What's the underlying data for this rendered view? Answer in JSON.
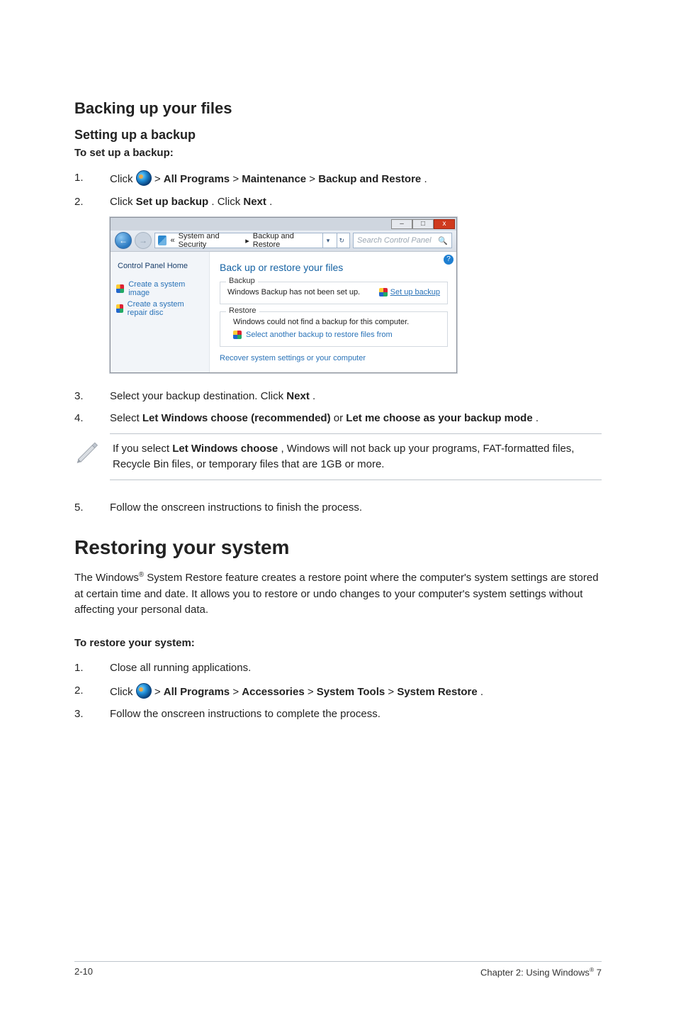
{
  "section1": {
    "title": "Backing up your files",
    "subtitle": "Setting up a backup",
    "lead": "To set up a backup:",
    "steps": {
      "s1_num": "1.",
      "s1_pre": "Click ",
      "s1_gt1": " > ",
      "s1_b1": "All Programs",
      "s1_gt2": " > ",
      "s1_b2": "Maintenance",
      "s1_gt3": " > ",
      "s1_b3": "Backup and Restore",
      "s1_end": ".",
      "s2_num": "2.",
      "s2_pre": "Click ",
      "s2_b1": "Set up backup",
      "s2_mid": ". Click ",
      "s2_b2": "Next",
      "s2_end": ".",
      "s3_num": "3.",
      "s3_pre": "Select your backup destination. Click ",
      "s3_b1": "Next",
      "s3_end": ".",
      "s4_num": "4.",
      "s4_pre": "Select ",
      "s4_b1": "Let Windows choose (recommended)",
      "s4_mid": " or ",
      "s4_b2": "Let me choose as your backup mode",
      "s4_end": ".",
      "s5_num": "5.",
      "s5_text": "Follow the onscreen instructions to finish the process."
    },
    "note": {
      "pre": "If you select ",
      "bold": "Let Windows choose",
      "post": ", Windows will not back up your programs, FAT-formatted files, Recycle Bin files, or temporary files that are 1GB or more."
    }
  },
  "screenshot": {
    "min_label": "–",
    "max_label": "□",
    "close_label": "x",
    "back_arrow": "←",
    "fwd_arrow": "→",
    "breadcrumb_prefix": "« ",
    "breadcrumb_1": "System and Security",
    "breadcrumb_sep": "  ▸  ",
    "breadcrumb_2": "Backup and Restore",
    "addr_drop": "▾",
    "addr_refresh": "↻",
    "search_placeholder": "Search Control Panel",
    "search_icon": "🔍",
    "help_icon": "?",
    "side_home": "Control Panel Home",
    "side_link1": "Create a system image",
    "side_link2": "Create a system repair disc",
    "main_title": "Back up or restore your files",
    "backup_legend": "Backup",
    "backup_status": "Windows Backup has not been set up.",
    "setup_text": "Set up backup",
    "restore_legend": "Restore",
    "restore_msg": "Windows could not find a backup for this computer.",
    "restore_link": "Select another backup to restore files from",
    "recover_link": "Recover system settings or your computer"
  },
  "section2": {
    "title": "Restoring your system",
    "para_pre": "The Windows",
    "para_sup": "®",
    "para_post": " System Restore feature creates a restore point where the computer's system settings are stored at certain time and date. It allows you to restore or undo changes to your computer's system settings without affecting your personal data.",
    "lead": "To restore your system:",
    "steps": {
      "s1_num": "1.",
      "s1_text": "Close all running applications.",
      "s2_num": "2.",
      "s2_pre": "Click ",
      "s2_gt1": " > ",
      "s2_b1": "All Programs",
      "s2_gt2": " > ",
      "s2_b2": "Accessories",
      "s2_gt3": " > ",
      "s2_b3": "System Tools",
      "s2_gt4": " > ",
      "s2_b4": "System Restore",
      "s2_end": ".",
      "s3_num": "3.",
      "s3_text": "Follow the onscreen instructions to complete the process."
    }
  },
  "footer": {
    "left": "2-10",
    "right_pre": "Chapter 2: Using Windows",
    "right_sup": "®",
    "right_post": " 7"
  }
}
